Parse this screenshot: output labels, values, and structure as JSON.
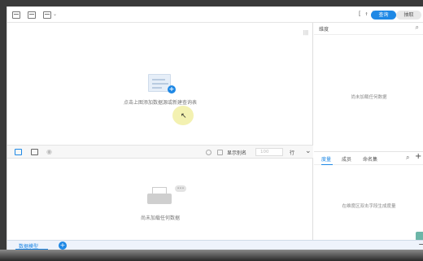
{
  "toolbar": {
    "bracket_label": "[ ↑ ]",
    "mode_on_label": "查询",
    "mode_off_label": "抽取",
    "icons": [
      "table-icon",
      "layout-icon",
      "chart-dropdown-icon"
    ]
  },
  "center": {
    "empty_hint": "点击上图添加数据源或新建查询表",
    "collapse_glyph": "|||"
  },
  "dimensions": {
    "title": "维度",
    "empty_text": "尚未加载任何数据"
  },
  "midbar": {
    "show_alias_label": "显示别名",
    "rows_placeholder": "100",
    "rows_unit": "行"
  },
  "lower": {
    "empty_text": "尚未加载任何数据",
    "bubble_text": "•••"
  },
  "measure_panel": {
    "tabs": [
      {
        "label": "度量",
        "active": true
      },
      {
        "label": "成员",
        "active": false
      },
      {
        "label": "命名集",
        "active": false
      }
    ],
    "empty_text": "在维度区双击字段生成度量"
  },
  "bottom": {
    "tab_label": "数据模型",
    "add_label": "+",
    "minus_label": "−"
  },
  "colors": {
    "accent": "#1e88e5",
    "cursor_halo": "#f2f0a8"
  }
}
